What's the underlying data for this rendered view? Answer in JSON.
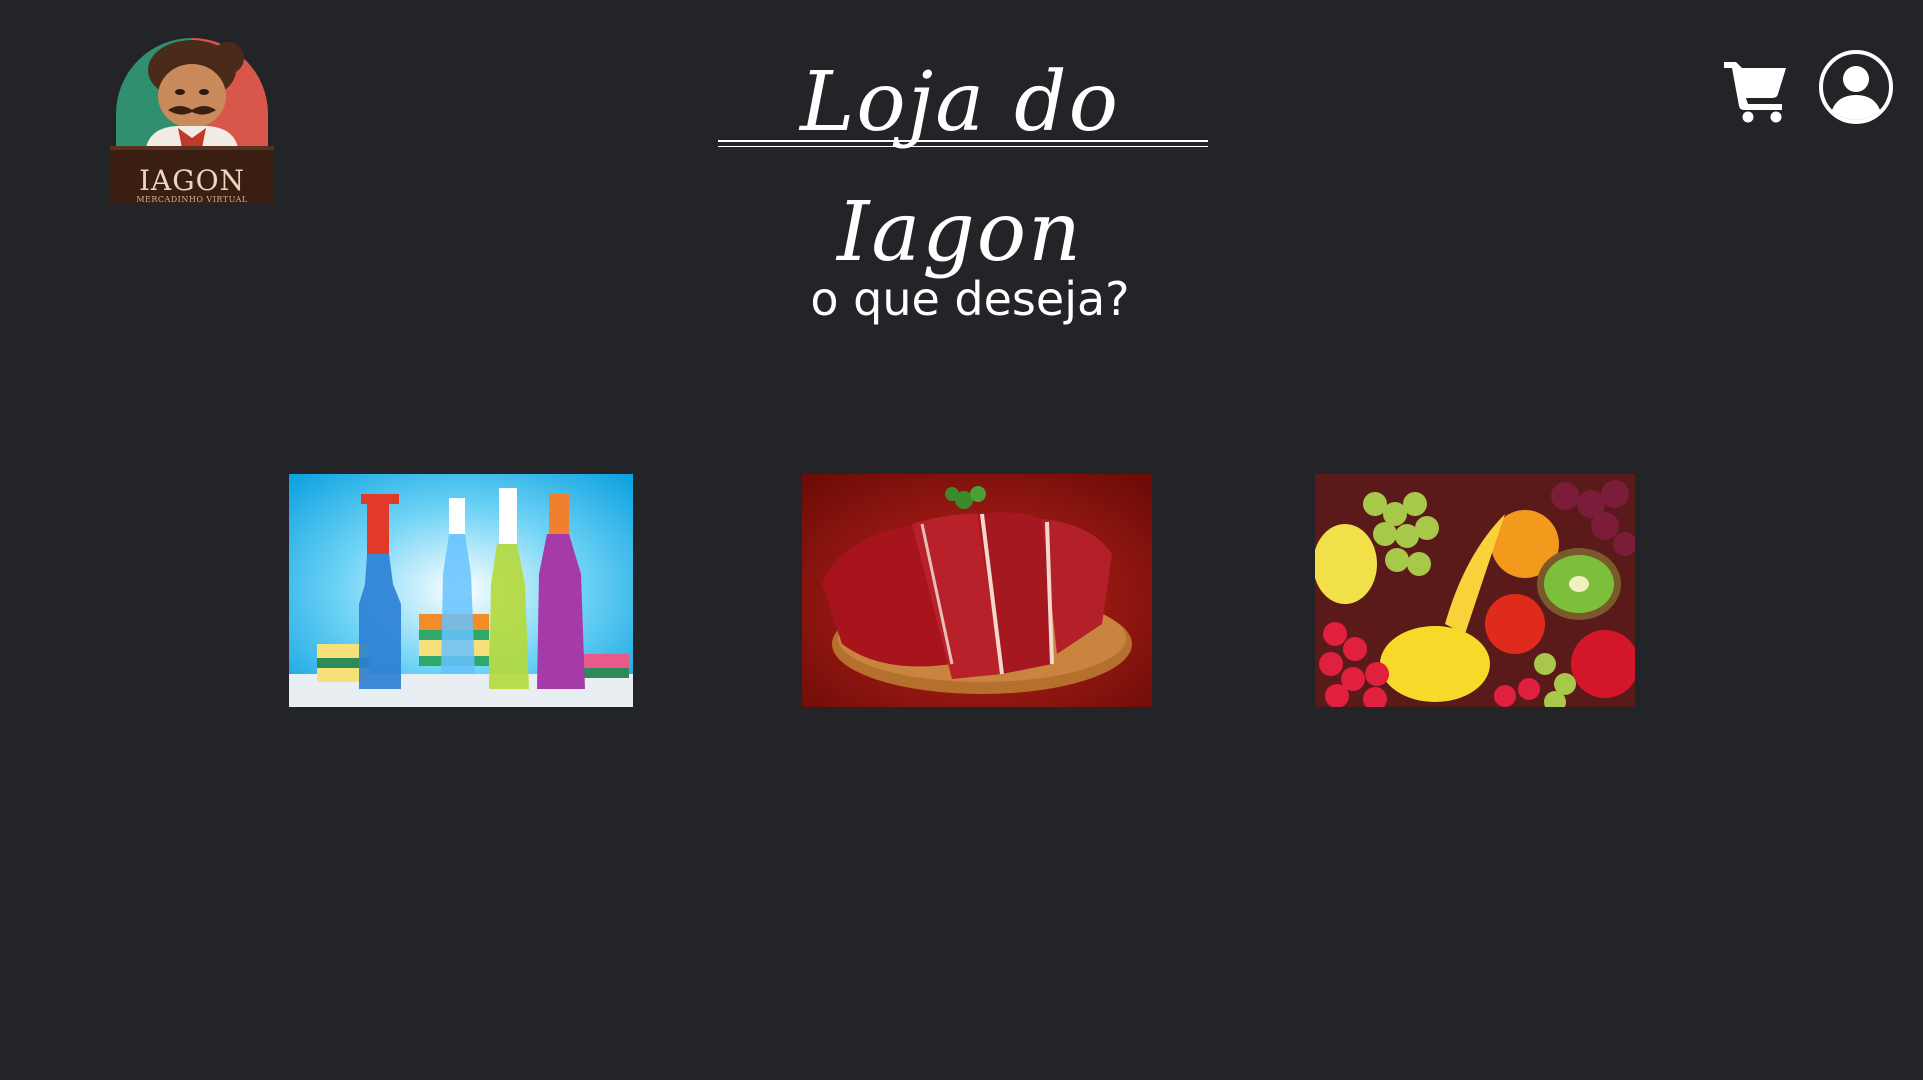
{
  "header": {
    "logo": {
      "brand": "IAGON",
      "subtitle": "MERCADINHO VIRTUAL",
      "icon": "mascot-logo"
    },
    "title": "Loja do Iagon",
    "cart_icon": "shopping-cart-icon",
    "profile_icon": "user-profile-icon"
  },
  "main": {
    "prompt": "o que deseja?",
    "categories": [
      {
        "image": "cleaning-products-image"
      },
      {
        "image": "meat-cuts-image"
      },
      {
        "image": "fruits-image"
      }
    ]
  },
  "colors": {
    "background": "#232427",
    "text": "#ffffff"
  }
}
